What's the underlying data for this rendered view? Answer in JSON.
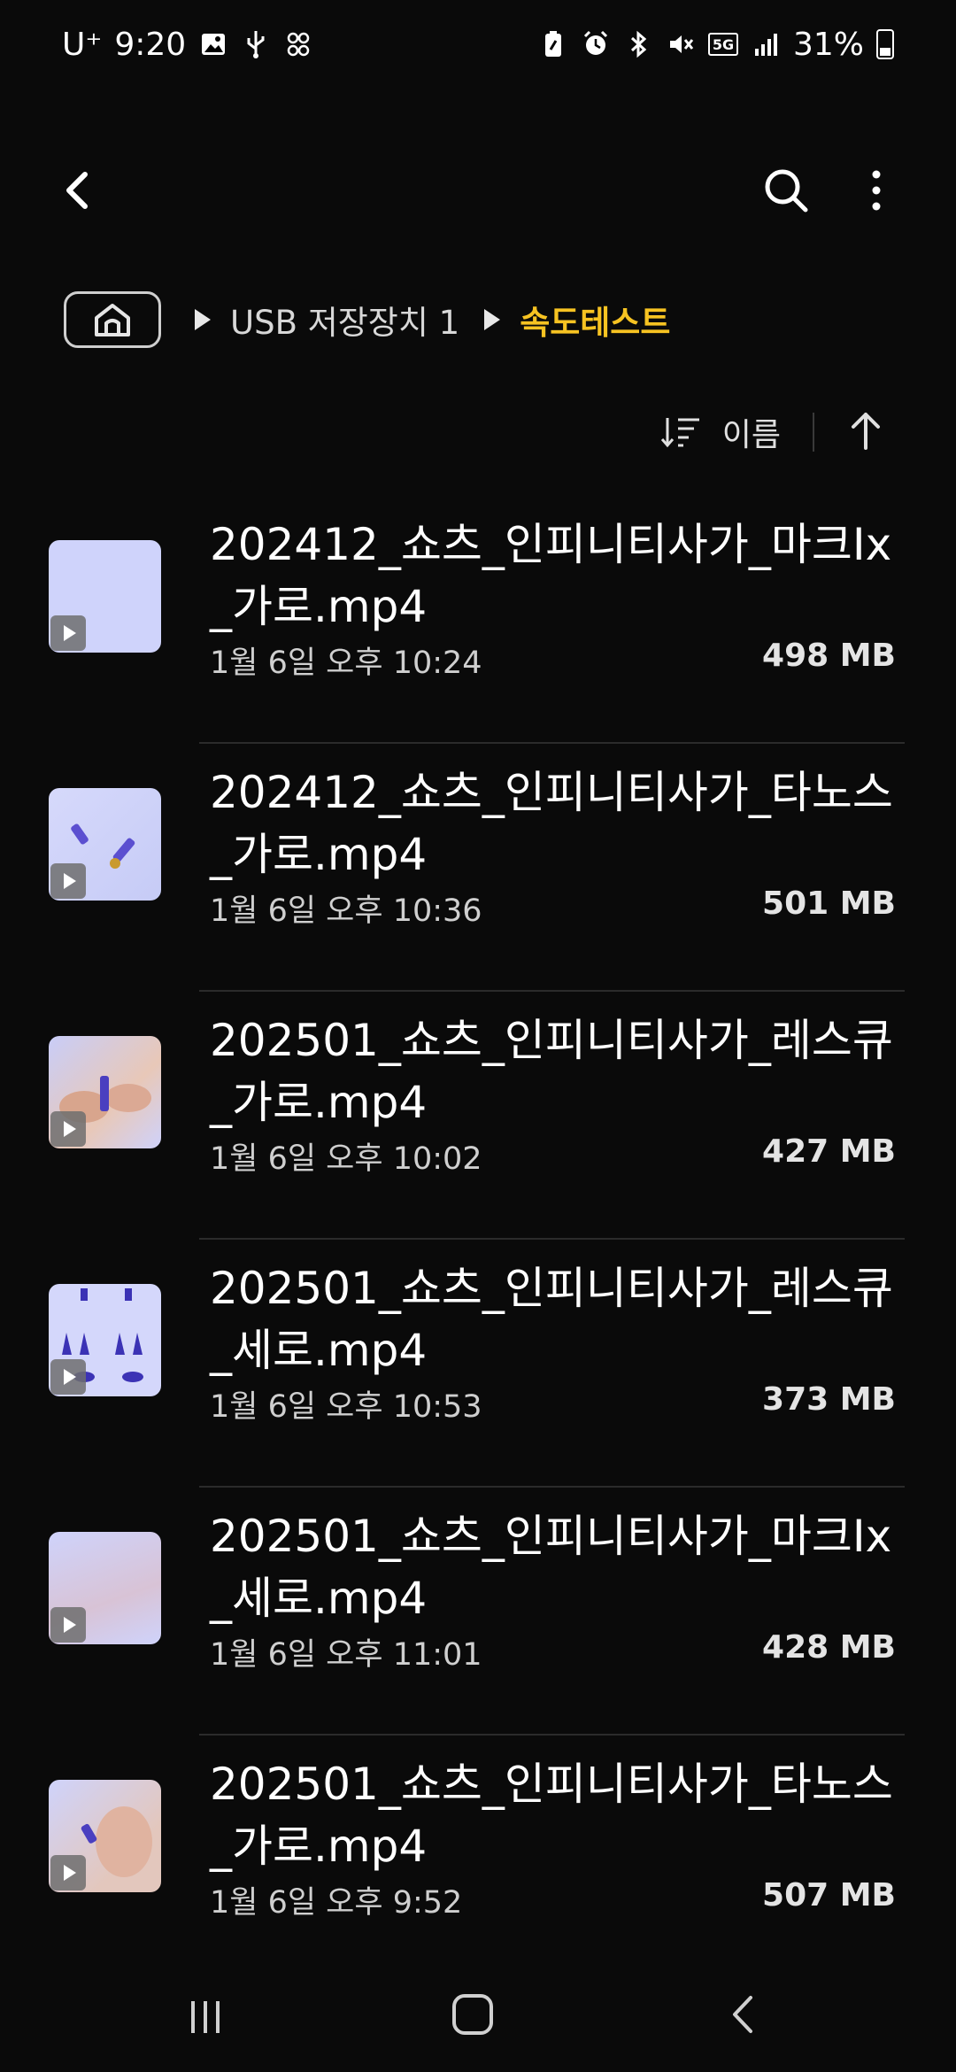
{
  "status_bar": {
    "carrier": "U⁺",
    "time": "9:20",
    "battery": "31%",
    "network": "5G",
    "icons": [
      "image-icon",
      "usb-icon",
      "nfc-icon",
      "battery-saver-icon",
      "alarm-icon",
      "bluetooth-icon",
      "mute-icon",
      "signal-icon",
      "battery-icon"
    ]
  },
  "breadcrumb": {
    "items": [
      "USB 저장장치 1",
      "속도테스트"
    ],
    "active_color": "#f7c322"
  },
  "sort": {
    "label": "이름"
  },
  "files": [
    {
      "name": "202412_쇼츠_인피니티사가_마크Ix_가로.mp4",
      "date": "1월 6일 오후 10:24",
      "size": "498 MB"
    },
    {
      "name": "202412_쇼츠_인피니티사가_타노스_가로.mp4",
      "date": "1월 6일 오후 10:36",
      "size": "501 MB"
    },
    {
      "name": "202501_쇼츠_인피니티사가_레스큐_가로.mp4",
      "date": "1월 6일 오후 10:02",
      "size": "427 MB"
    },
    {
      "name": "202501_쇼츠_인피니티사가_레스큐_세로.mp4",
      "date": "1월 6일 오후 10:53",
      "size": "373 MB"
    },
    {
      "name": "202501_쇼츠_인피니티사가_마크Ix_세로.mp4",
      "date": "1월 6일 오후 11:01",
      "size": "428 MB"
    },
    {
      "name": "202501_쇼츠_인피니티사가_타노스_가로.mp4",
      "date": "1월 6일 오후 9:52",
      "size": "507 MB"
    }
  ]
}
